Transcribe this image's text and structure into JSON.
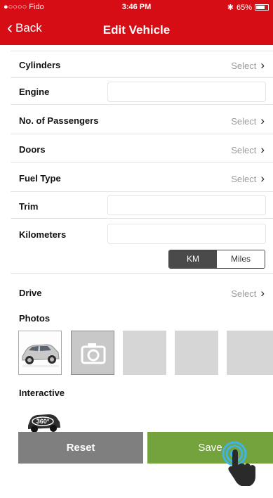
{
  "status": {
    "carrier": "●○○○○ Fido",
    "time": "3:46 PM",
    "battery": "65%"
  },
  "nav": {
    "back": "Back",
    "title": "Edit Vehicle"
  },
  "fields": {
    "cylinders": {
      "label": "Cylinders",
      "value": "Select"
    },
    "engine": {
      "label": "Engine",
      "value": ""
    },
    "passengers": {
      "label": "No. of Passengers",
      "value": "Select"
    },
    "doors": {
      "label": "Doors",
      "value": "Select"
    },
    "fuel": {
      "label": "Fuel Type",
      "value": "Select"
    },
    "trim": {
      "label": "Trim",
      "value": ""
    },
    "kilometers": {
      "label": "Kilometers",
      "value": ""
    },
    "drive": {
      "label": "Drive",
      "value": "Select"
    }
  },
  "units": {
    "km": "KM",
    "miles": "Miles",
    "selected": "KM"
  },
  "photos": {
    "label": "Photos"
  },
  "interactive": {
    "label": "Interactive",
    "badge": "360°"
  },
  "buttons": {
    "reset": "Reset",
    "save": "Save"
  }
}
